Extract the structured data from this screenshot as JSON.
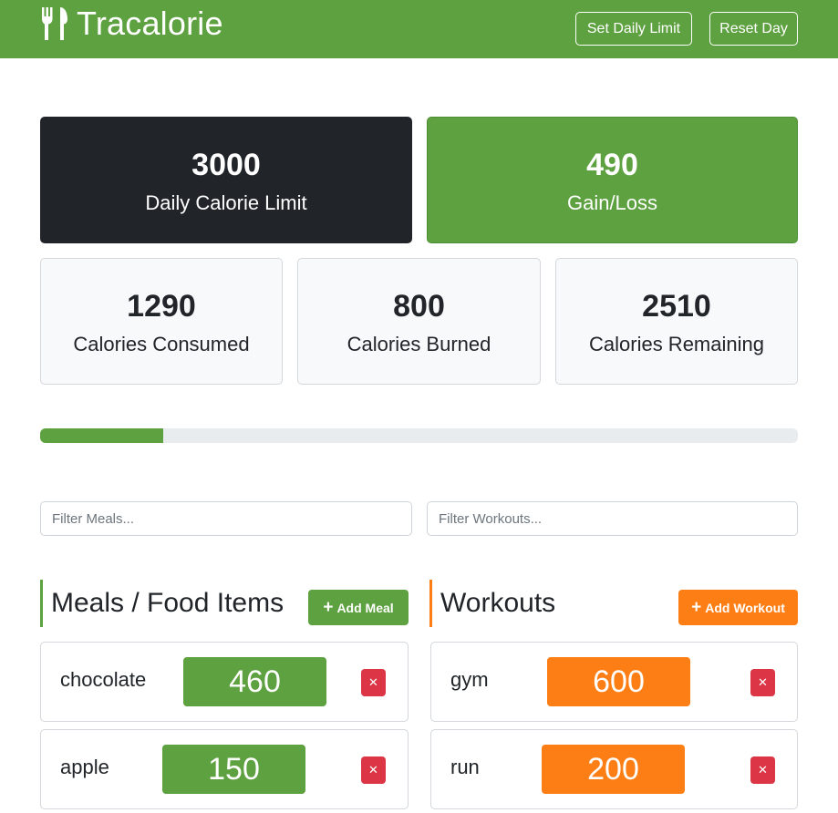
{
  "navbar": {
    "brand": "Tracalorie",
    "brand_icon": "utensils-icon",
    "set_limit_label": "Set Daily Limit",
    "reset_day_label": "Reset Day",
    "color": "#5ea140"
  },
  "stats": {
    "daily_limit": {
      "value": "3000",
      "label": "Daily Calorie Limit"
    },
    "gain_loss": {
      "value": "490",
      "label": "Gain/Loss"
    },
    "consumed": {
      "value": "1290",
      "label": "Calories Consumed"
    },
    "burned": {
      "value": "800",
      "label": "Calories Burned"
    },
    "remaining": {
      "value": "2510",
      "label": "Calories Remaining"
    }
  },
  "progress": {
    "fraction": 0.163,
    "color": "#5ea140"
  },
  "filters": {
    "meals_placeholder": "Filter Meals...",
    "workouts_placeholder": "Filter Workouts..."
  },
  "meals": {
    "title": "Meals / Food Items",
    "add_label": "Add Meal",
    "color": "#5ea140",
    "items": [
      {
        "name": "chocolate",
        "calories": "460",
        "delete": "✕"
      },
      {
        "name": "apple",
        "calories": "150",
        "delete": "✕"
      }
    ]
  },
  "workouts": {
    "title": "Workouts",
    "add_label": "Add Workout",
    "color": "#fd7e14",
    "items": [
      {
        "name": "gym",
        "calories": "600",
        "delete": "✕"
      },
      {
        "name": "run",
        "calories": "200",
        "delete": "✕"
      }
    ]
  }
}
